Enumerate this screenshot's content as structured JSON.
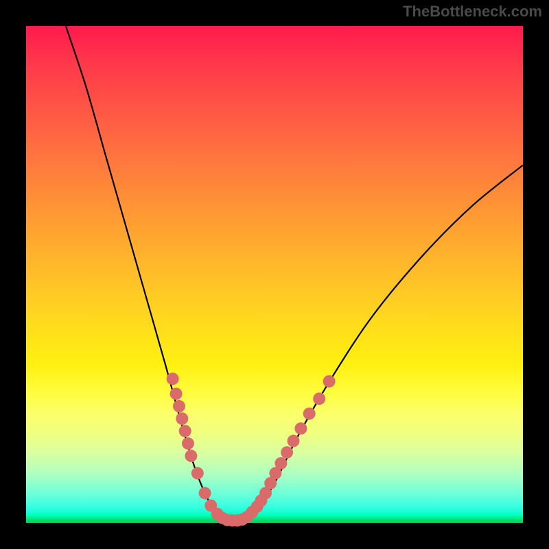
{
  "watermark": "TheBottleneck.com",
  "chart_data": {
    "type": "line",
    "title": "",
    "xlabel": "",
    "ylabel": "",
    "xlim": [
      0,
      100
    ],
    "ylim": [
      0,
      100
    ],
    "curve": {
      "name": "bottleneck-curve",
      "points": [
        {
          "x": 8,
          "y": 100
        },
        {
          "x": 12,
          "y": 88
        },
        {
          "x": 16,
          "y": 74
        },
        {
          "x": 20,
          "y": 60
        },
        {
          "x": 24,
          "y": 46
        },
        {
          "x": 28,
          "y": 32
        },
        {
          "x": 31,
          "y": 21
        },
        {
          "x": 34,
          "y": 11
        },
        {
          "x": 37,
          "y": 4
        },
        {
          "x": 40,
          "y": 0.5
        },
        {
          "x": 43,
          "y": 0.5
        },
        {
          "x": 46,
          "y": 2
        },
        {
          "x": 50,
          "y": 8
        },
        {
          "x": 55,
          "y": 18
        },
        {
          "x": 62,
          "y": 30
        },
        {
          "x": 70,
          "y": 42
        },
        {
          "x": 80,
          "y": 54
        },
        {
          "x": 90,
          "y": 64
        },
        {
          "x": 100,
          "y": 72
        }
      ]
    },
    "markers": {
      "left_cluster": [
        {
          "x": 29.5,
          "y": 29
        },
        {
          "x": 30.2,
          "y": 26
        },
        {
          "x": 30.8,
          "y": 23.5
        },
        {
          "x": 31.4,
          "y": 21
        },
        {
          "x": 32.0,
          "y": 18.5
        },
        {
          "x": 32.6,
          "y": 16
        },
        {
          "x": 33.2,
          "y": 13.5
        },
        {
          "x": 34.5,
          "y": 10
        },
        {
          "x": 36.0,
          "y": 6
        },
        {
          "x": 37.2,
          "y": 3.5
        }
      ],
      "bottom_cluster": [
        {
          "x": 38.5,
          "y": 1.8
        },
        {
          "x": 39.5,
          "y": 1.0
        },
        {
          "x": 40.5,
          "y": 0.6
        },
        {
          "x": 41.5,
          "y": 0.5
        },
        {
          "x": 42.5,
          "y": 0.5
        },
        {
          "x": 43.5,
          "y": 0.7
        },
        {
          "x": 44.5,
          "y": 1.2
        },
        {
          "x": 45.5,
          "y": 2.2
        },
        {
          "x": 46.5,
          "y": 3.3
        },
        {
          "x": 47.3,
          "y": 4.5
        }
      ],
      "right_cluster": [
        {
          "x": 48.2,
          "y": 6
        },
        {
          "x": 49.2,
          "y": 8
        },
        {
          "x": 50.2,
          "y": 10
        },
        {
          "x": 51.3,
          "y": 12
        },
        {
          "x": 52.5,
          "y": 14.2
        },
        {
          "x": 53.8,
          "y": 16.5
        },
        {
          "x": 55.3,
          "y": 19
        },
        {
          "x": 57.0,
          "y": 22
        },
        {
          "x": 59.0,
          "y": 25
        },
        {
          "x": 61.0,
          "y": 28.5
        }
      ]
    },
    "marker_style": {
      "color": "#d96b6b",
      "radius": 9
    },
    "curve_style": {
      "color": "#000000",
      "width": 2.2
    }
  }
}
